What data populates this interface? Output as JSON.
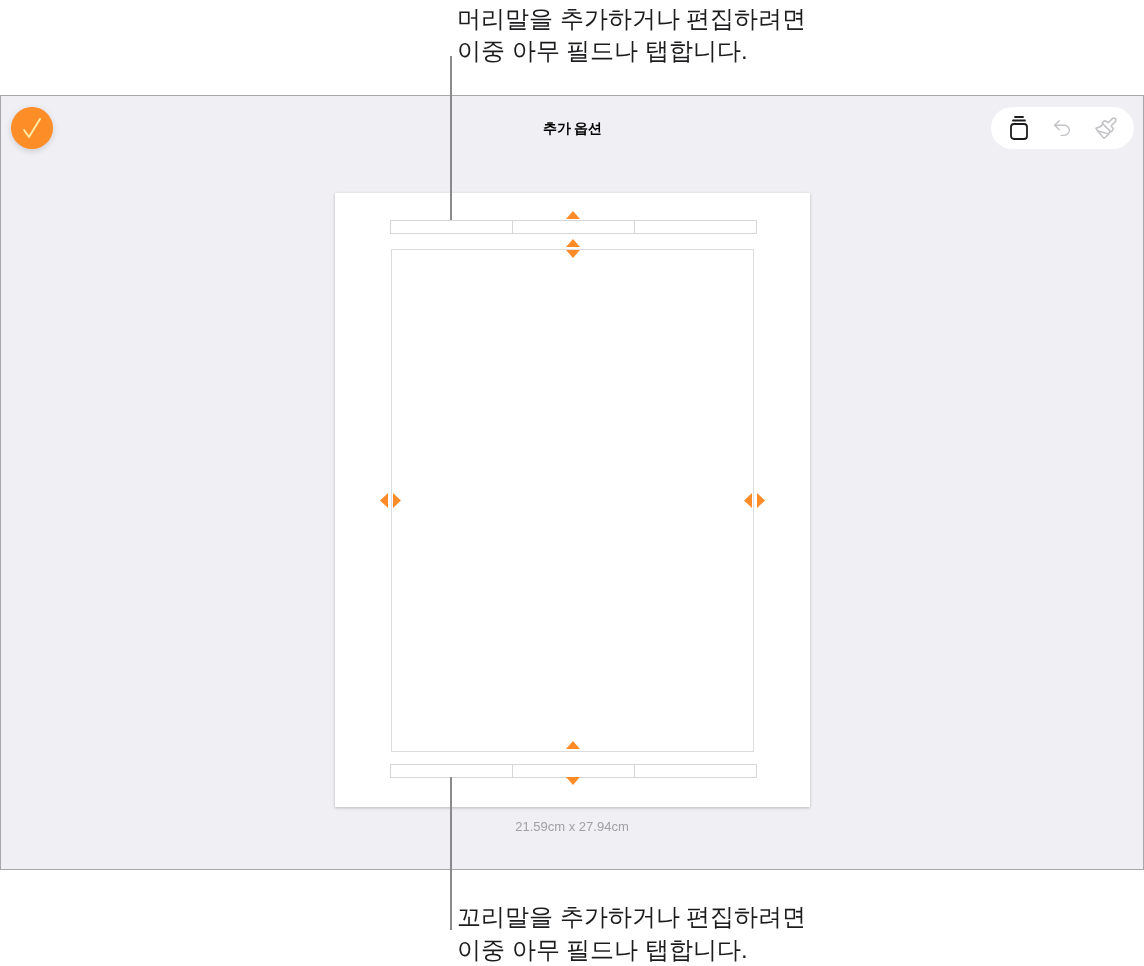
{
  "header_callout": {
    "text": "머리말을 추가하거나 편집하려면\n이중 아무 필드나 탭합니다."
  },
  "screen": {
    "title": "추가 옵션",
    "toolbar": [
      {
        "kind": "pages",
        "disabled": false
      },
      {
        "kind": "undo",
        "disabled": true
      },
      {
        "kind": "brush",
        "disabled": true
      }
    ],
    "page_size": "21.59cm x 27.94cm"
  },
  "footer_callout": {
    "text": "꼬리말을 추가하거나 편집하려면\n이중 아무 필드나 탭합니다."
  }
}
